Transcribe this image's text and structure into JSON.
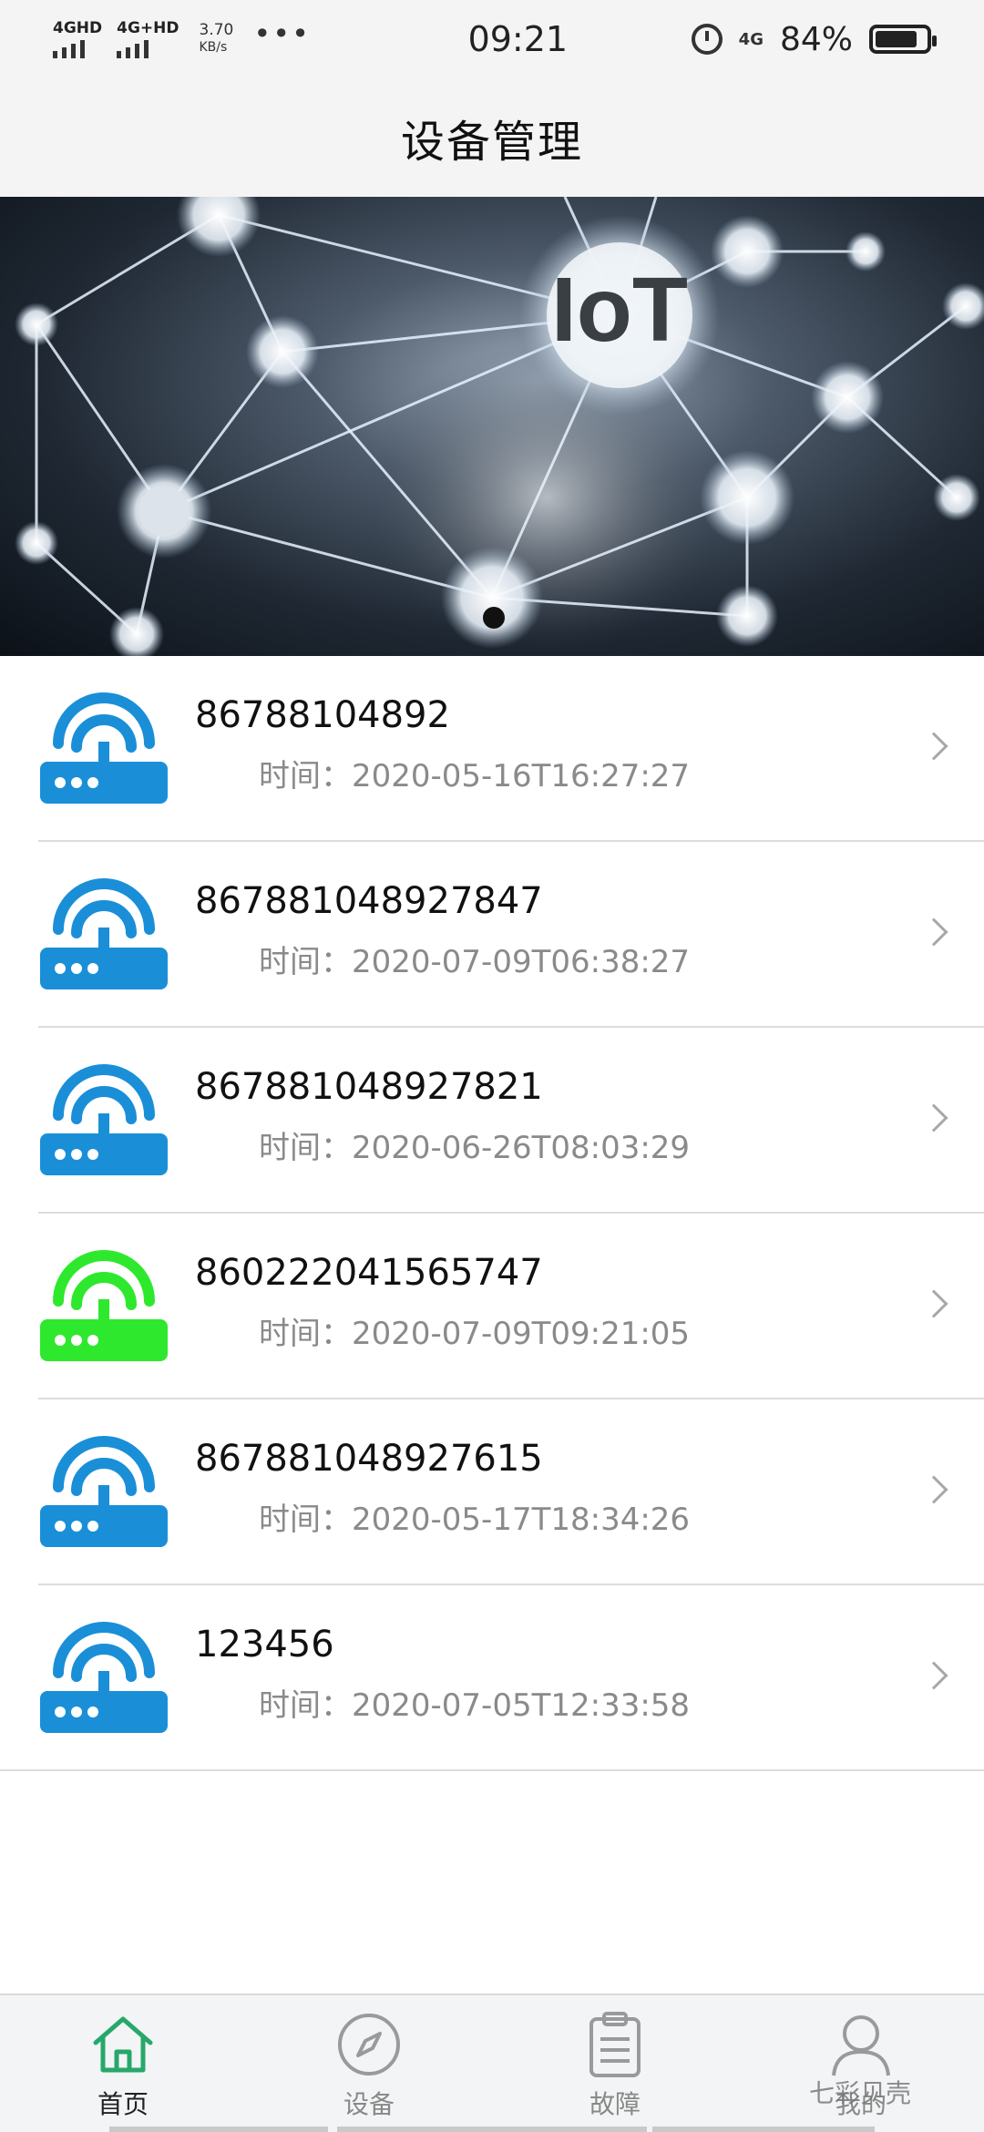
{
  "status_bar": {
    "signal1": "4GHD",
    "signal2": "4G+HD",
    "speed_value": "3.70",
    "speed_unit": "KB/s",
    "more": "•••",
    "time": "09:21",
    "lte": "4G",
    "battery": "84%",
    "battery_level": 0.84
  },
  "header": {
    "title": "设备管理"
  },
  "banner": {
    "text": "IoT"
  },
  "devices": [
    {
      "id": "86788104892",
      "time_text": "时间：2020-05-16T16:27:27",
      "icon_color": "#1a8fd8"
    },
    {
      "id": "867881048927847",
      "time_text": "时间：2020-07-09T06:38:27",
      "icon_color": "#1a8fd8"
    },
    {
      "id": "867881048927821",
      "time_text": "时间：2020-06-26T08:03:29",
      "icon_color": "#1a8fd8"
    },
    {
      "id": "860222041565747",
      "time_text": "时间：2020-07-09T09:21:05",
      "icon_color": "#2ee82e"
    },
    {
      "id": "867881048927615",
      "time_text": "时间：2020-05-17T18:34:26",
      "icon_color": "#1a8fd8"
    },
    {
      "id": "123456",
      "time_text": "时间：2020-07-05T12:33:58",
      "icon_color": "#1a8fd8"
    }
  ],
  "tabs": [
    {
      "label": "首页",
      "icon": "home-icon",
      "active": true
    },
    {
      "label": "设备",
      "icon": "compass-icon",
      "active": false
    },
    {
      "label": "故障",
      "icon": "clipboard-icon",
      "active": false
    },
    {
      "label": "我的",
      "icon": "user-icon",
      "active": false
    }
  ],
  "colors": {
    "active_tab": "#26a86a",
    "inactive_tab": "#9a9a9a"
  },
  "watermark": "七彩贝壳"
}
